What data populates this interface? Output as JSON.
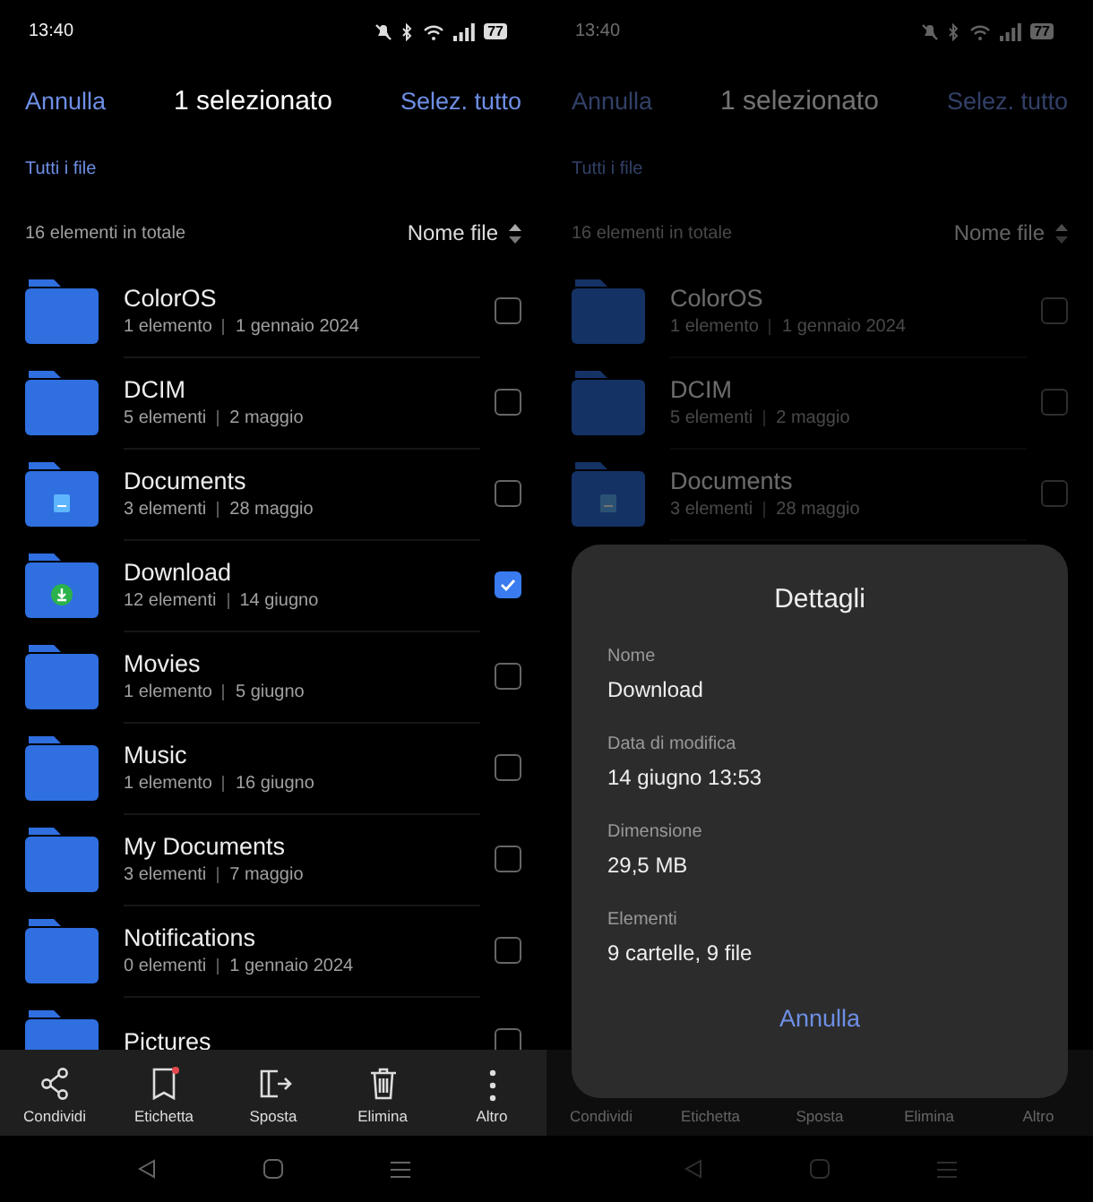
{
  "screens": [
    {
      "dimmed": false,
      "status_bar": {
        "time": "13:40",
        "battery": "77"
      },
      "header": {
        "cancel": "Annulla",
        "title": "1 selezionato",
        "select_all": "Selez. tutto"
      },
      "breadcrumb": "Tutti i file",
      "count": "16 elementi in totale",
      "sort": "Nome file",
      "files": [
        {
          "name": "ColorOS",
          "items": "1 elemento",
          "date": "1 gennaio 2024",
          "kind": "plain",
          "selected": false
        },
        {
          "name": "DCIM",
          "items": "5 elementi",
          "date": "2 maggio",
          "kind": "plain",
          "selected": false
        },
        {
          "name": "Documents",
          "items": "3 elementi",
          "date": "28 maggio",
          "kind": "docs",
          "selected": false
        },
        {
          "name": "Download",
          "items": "12 elementi",
          "date": "14 giugno",
          "kind": "download",
          "selected": true
        },
        {
          "name": "Movies",
          "items": "1 elemento",
          "date": "5 giugno",
          "kind": "plain",
          "selected": false
        },
        {
          "name": "Music",
          "items": "1 elemento",
          "date": "16 giugno",
          "kind": "plain",
          "selected": false
        },
        {
          "name": "My Documents",
          "items": "3 elementi",
          "date": "7 maggio",
          "kind": "plain",
          "selected": false
        },
        {
          "name": "Notifications",
          "items": "0 elementi",
          "date": "1 gennaio 2024",
          "kind": "plain",
          "selected": false
        },
        {
          "name": "Pictures",
          "kind": "plain",
          "selected": false
        }
      ],
      "toolbar": [
        {
          "label": "Condividi",
          "kind": "share"
        },
        {
          "label": "Etichetta",
          "kind": "tag"
        },
        {
          "label": "Sposta",
          "kind": "move"
        },
        {
          "label": "Elimina",
          "kind": "delete"
        },
        {
          "label": "Altro",
          "kind": "more"
        }
      ]
    },
    {
      "dimmed": true,
      "status_bar": {
        "time": "13:40",
        "battery": "77"
      },
      "header": {
        "cancel": "Annulla",
        "title": "1 selezionato",
        "select_all": "Selez. tutto"
      },
      "breadcrumb": "Tutti i file",
      "count": "16 elementi in totale",
      "sort": "Nome file",
      "files": [
        {
          "name": "ColorOS",
          "items": "1 elemento",
          "date": "1 gennaio 2024",
          "kind": "plain",
          "selected": false
        },
        {
          "name": "DCIM",
          "items": "5 elementi",
          "date": "2 maggio",
          "kind": "plain",
          "selected": false
        },
        {
          "name": "Documents",
          "items": "3 elementi",
          "date": "28 maggio",
          "kind": "docs",
          "selected": false
        }
      ],
      "toolbar": [
        {
          "label": "Condividi"
        },
        {
          "label": "Etichetta"
        },
        {
          "label": "Sposta"
        },
        {
          "label": "Elimina"
        },
        {
          "label": "Altro"
        }
      ],
      "dialog": {
        "title": "Dettagli",
        "fields": [
          {
            "label": "Nome",
            "value": "Download"
          },
          {
            "label": "Data di modifica",
            "value": "14 giugno 13:53"
          },
          {
            "label": "Dimensione",
            "value": "29,5 MB"
          },
          {
            "label": "Elementi",
            "value": "9 cartelle, 9 file"
          }
        ],
        "button": "Annulla"
      }
    }
  ]
}
